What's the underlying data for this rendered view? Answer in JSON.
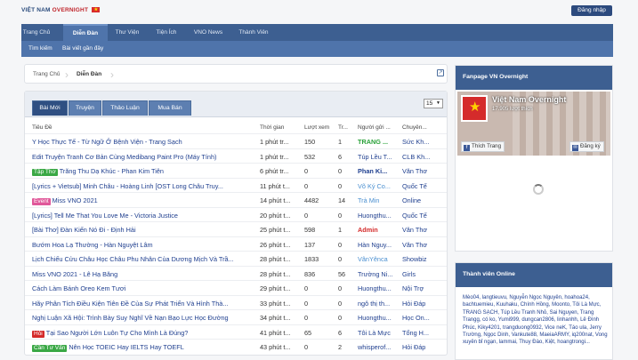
{
  "header": {
    "logo_text": "VIỆT NAM",
    "logo_accent": "OVERNIGHT",
    "login_label": "Đăng nhập"
  },
  "nav": {
    "tabs": [
      {
        "label": "Trang Chủ"
      },
      {
        "label": "Diễn Đàn"
      },
      {
        "label": "Thư Viện"
      },
      {
        "label": "Tiện Ích"
      },
      {
        "label": "VNO News"
      },
      {
        "label": "Thành Viên"
      }
    ],
    "active_index": 1,
    "sub": [
      {
        "label": "Tìm kiếm"
      },
      {
        "label": "Bài viết gần đây"
      }
    ]
  },
  "breadcrumb": {
    "home": "Trang Chủ",
    "current": "Diễn Đàn"
  },
  "panel": {
    "tabs": [
      {
        "label": "Bài Mới"
      },
      {
        "label": "Truyện"
      },
      {
        "label": "Thảo Luận"
      },
      {
        "label": "Mua Bán"
      }
    ],
    "page_size": "15",
    "columns": {
      "title": "Tiêu Đề",
      "time": "Thời gian",
      "views": "Lượt xem",
      "replies": "Tr...",
      "user": "Người gửi ...",
      "cat": "Chuyên..."
    },
    "rows": [
      {
        "badge": "",
        "title": "Y Học Thực Tế - Từ Ngữ Ở Bệnh Viện - Trang Sạch",
        "time": "1 phút tr...",
        "views": "150",
        "replies": "1",
        "user": "TRANG ...",
        "user_color": "#2aa13a",
        "user_bold": true,
        "cat": "Sức Kh..."
      },
      {
        "badge": "",
        "title": "Edit Truyện Tranh Cơ Bản Cùng Medibang Paint Pro (Máy Tính)",
        "time": "1 phút tr...",
        "views": "532",
        "replies": "6",
        "user": "Túp Lều T...",
        "user_color": "#1f3f8f",
        "user_bold": false,
        "cat": "CLB Kh..."
      },
      {
        "badge": "Tập Thơ",
        "badge_color": "#3aa845",
        "title": "Trăng Thu Dạ Khúc - Phan Kim Tiên",
        "time": "6 phút tr...",
        "views": "0",
        "replies": "0",
        "user": "Phan Ki...",
        "user_color": "#1f3f8f",
        "user_bold": true,
        "cat": "Văn Thơ"
      },
      {
        "badge": "",
        "title": "[Lyrics + Vietsub] Minh Châu - Hoàng Linh [OST Long Châu Truy...",
        "time": "11 phút t...",
        "views": "0",
        "replies": "0",
        "user": "Võ Ký Co...",
        "user_color": "#4a8fd0",
        "user_bold": false,
        "cat": "Quốc Tế"
      },
      {
        "badge": "Event",
        "badge_color": "#e0589a",
        "title": "Miss VNO 2021",
        "time": "14 phút t...",
        "views": "4482",
        "replies": "14",
        "user": "Trà Min",
        "user_color": "#4a8fd0",
        "user_bold": false,
        "cat": "Online"
      },
      {
        "badge": "",
        "title": "[Lyrics] Tell Me That You Love Me - Victoria Justice",
        "time": "20 phút t...",
        "views": "0",
        "replies": "0",
        "user": "Huongthu...",
        "user_color": "#1f3f8f",
        "user_bold": false,
        "cat": "Quốc Tế"
      },
      {
        "badge": "",
        "title": "[Bài Thơ] Đàn Kiến Nó Đi - Định Hải",
        "time": "25 phút t...",
        "views": "598",
        "replies": "1",
        "user": "Admin",
        "user_color": "#d42a2a",
        "user_bold": true,
        "cat": "Văn Thơ"
      },
      {
        "badge": "",
        "title": "Bướm Hoa Lạ Thường - Hàn Nguyệt Lâm",
        "time": "26 phút t...",
        "views": "137",
        "replies": "0",
        "user": "Hàn Nguy...",
        "user_color": "#1f3f8f",
        "user_bold": false,
        "cat": "Văn Thơ"
      },
      {
        "badge": "",
        "title": "Lịch Chiếu Cửu Châu Học Châu Phu Nhân Của Dương Mịch Và Trầ...",
        "time": "28 phút t...",
        "views": "1833",
        "replies": "0",
        "user": "VânYênca",
        "user_color": "#4a8fd0",
        "user_bold": false,
        "cat": "Showbiz"
      },
      {
        "badge": "",
        "title": "Miss VNO 2021 - Lê Hạ Băng",
        "time": "28 phút t...",
        "views": "836",
        "replies": "56",
        "user": "Trường Ni...",
        "user_color": "#1f3f8f",
        "user_bold": false,
        "cat": "Girls"
      },
      {
        "badge": "",
        "title": "Cách Làm Bánh Oreo Kem Tươi",
        "time": "29 phút t...",
        "views": "0",
        "replies": "0",
        "user": "Huongthu...",
        "user_color": "#1f3f8f",
        "user_bold": false,
        "cat": "Nội Trợ"
      },
      {
        "badge": "",
        "title": "Hãy Phân Tích Điều Kiện Tiên Đề Của Sự Phát Triển Và Hình Thà...",
        "time": "33 phút t...",
        "views": "0",
        "replies": "0",
        "user": "ngô thị th...",
        "user_color": "#1f3f8f",
        "user_bold": false,
        "cat": "Hỏi Đáp"
      },
      {
        "badge": "",
        "title": "Nghị Luận Xã Hội: Trình Bày Suy Nghĩ Về Nạn Bạo Lực Học Đường",
        "time": "34 phút t...",
        "views": "0",
        "replies": "0",
        "user": "Huongthu...",
        "user_color": "#1f3f8f",
        "user_bold": false,
        "cat": "Học On..."
      },
      {
        "badge": "Hỏi",
        "badge_color": "#d42a2a",
        "title": "Tại Sao Người Lớn Luôn Tự Cho Mình Là Đúng?",
        "time": "41 phút t...",
        "views": "65",
        "replies": "6",
        "user": "Tôi Là Mực",
        "user_color": "#1f3f8f",
        "user_bold": false,
        "cat": "Tổng H..."
      },
      {
        "badge": "Cần Tư Vấn",
        "badge_color": "#3aa845",
        "title": "Nên Học TOEIC Hay IELTS Hay TOEFL",
        "time": "43 phút t...",
        "views": "0",
        "replies": "2",
        "user": "whisperof...",
        "user_color": "#1f3f8f",
        "user_bold": false,
        "cat": "Hỏi Đáp"
      }
    ]
  },
  "sidebar": {
    "fanpage_title": "Fanpage VN Overnight",
    "page_name": "Việt Nam Overnight",
    "page_likes": "17.905 lượt thích",
    "like_label": "Thích Trang",
    "signup_label": "Đăng ký",
    "online_title": "Thành viên Online",
    "online_text": "Mèo04, langtieuvu, Nguyễn Ngọc Nguyên, hoahoa24, bachtuemieu, Kuuhaku, Chính Hồng, Moonto, Tôi Là Mực, TRANG SẠCH, Túp Lều Tranh Nhỏ, Sai Nguyen, Trang Trangg, có ko, Yumi999, dungcan2806, linhanhh, Lê Đình Phúc, Kiky4201, trangduong0932, Vice neK, Táo ula, Jerry Trường, Ngọc Dinh, Vankute88, MaeiaARMY, iq200nat, Vong xuyên bỉ ngạn, lammai, Thuy Đào, Kiệt, hoangtrongi..."
  }
}
